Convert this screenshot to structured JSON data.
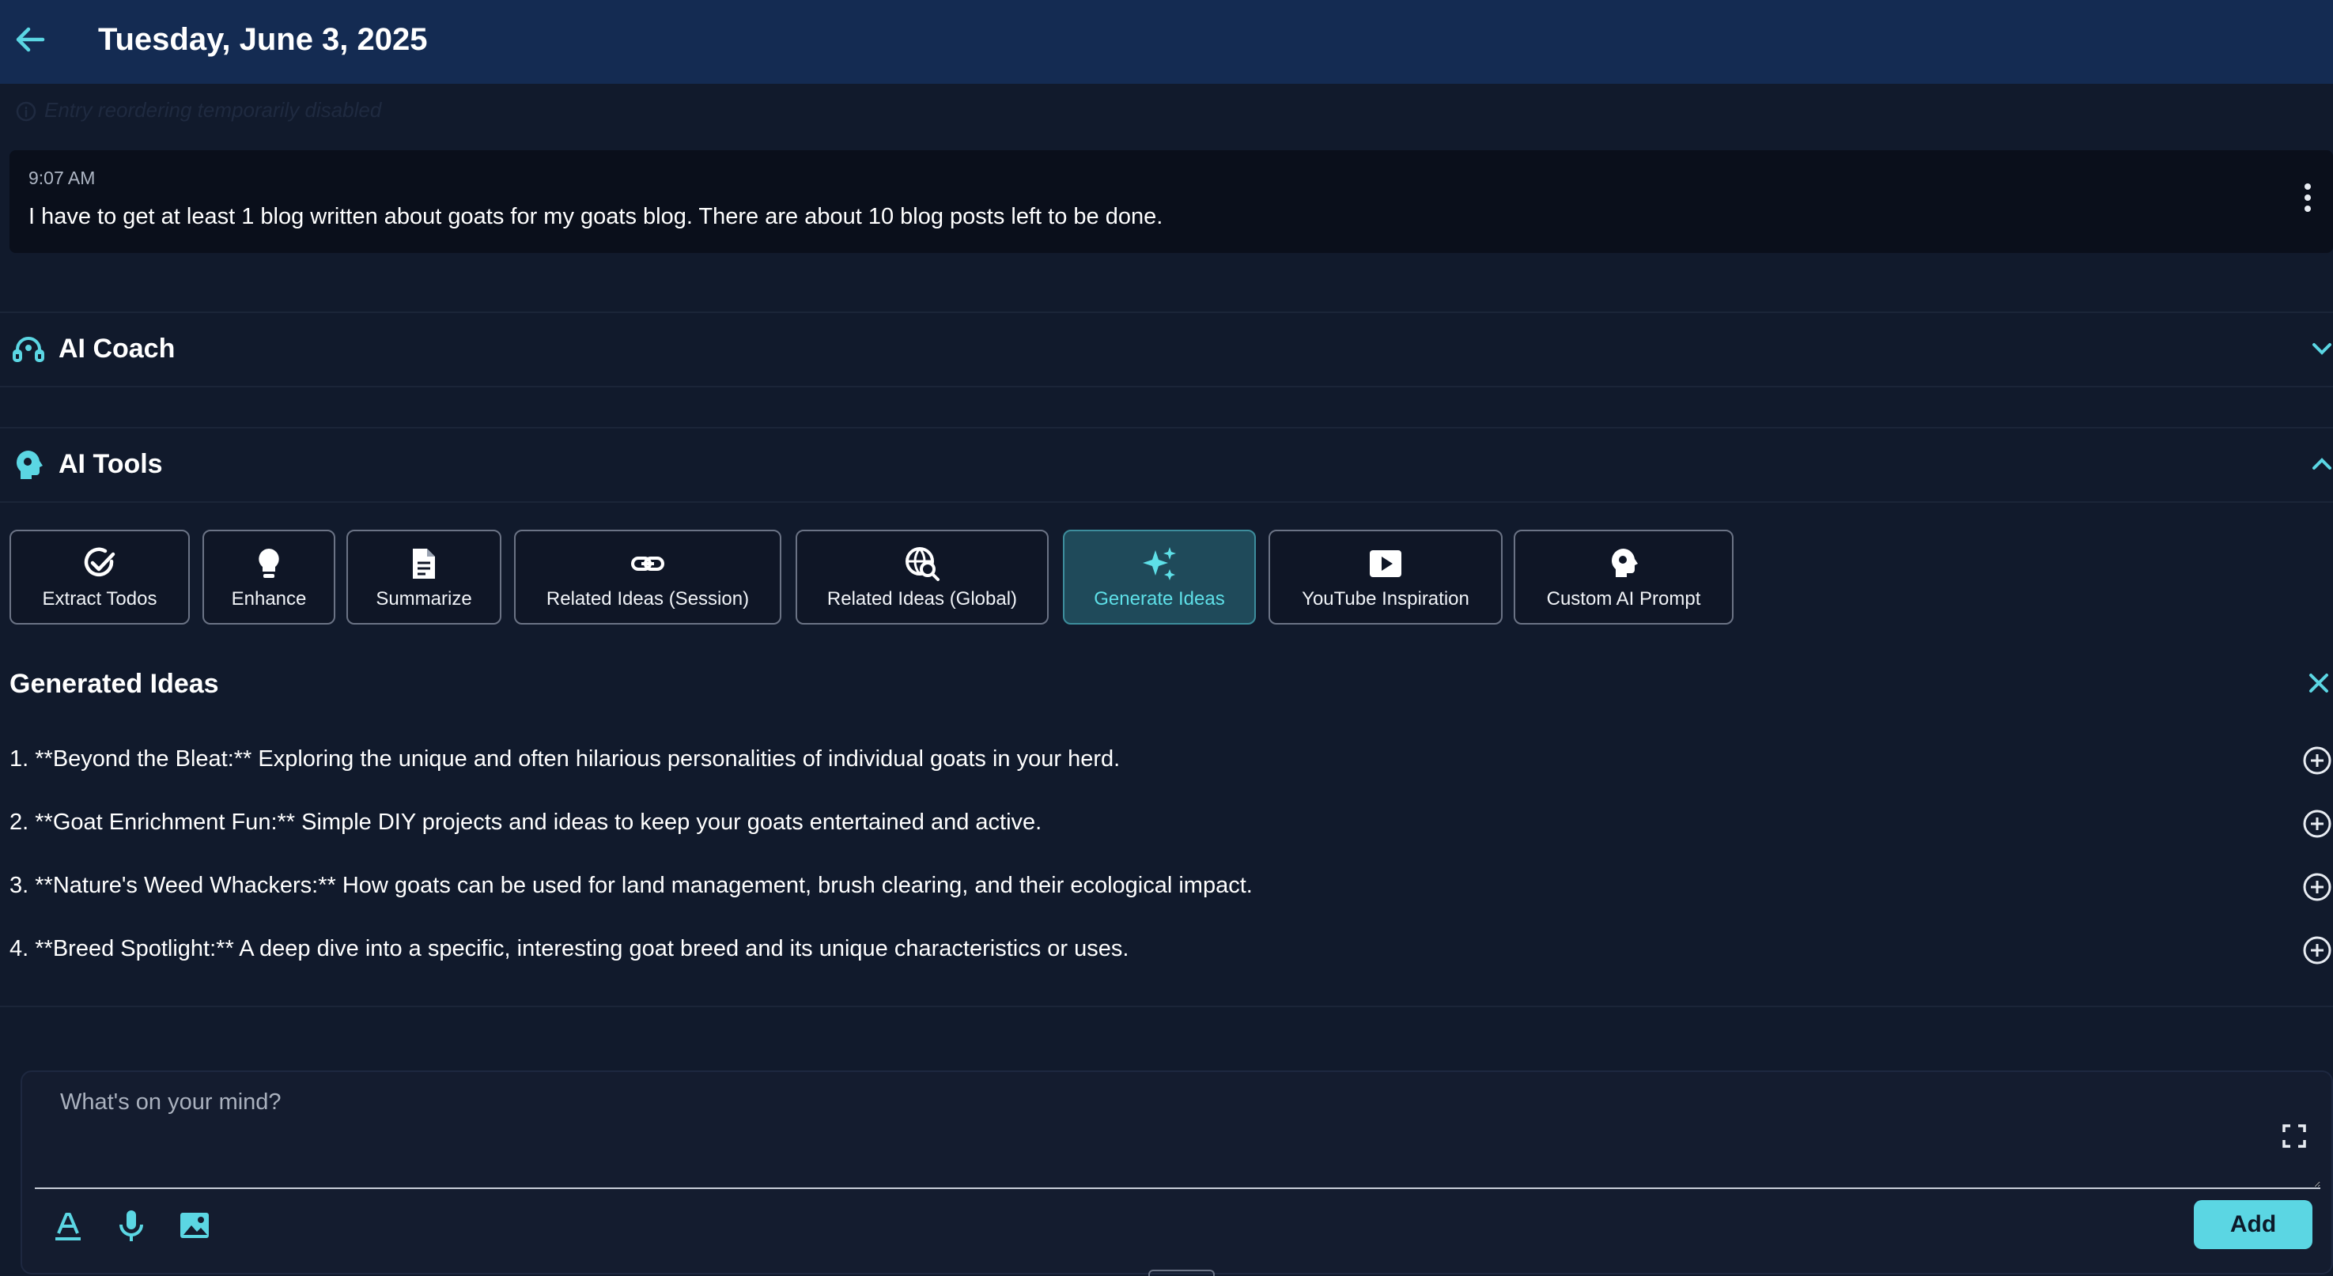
{
  "header": {
    "title": "Tuesday, June 3, 2025",
    "back_icon": "arrow-left-icon"
  },
  "notice": {
    "text": "Entry reordering temporarily disabled",
    "icon": "info-icon"
  },
  "entry": {
    "time": "9:07 AM",
    "text": "I have to get at least 1 blog written about goats for my goats blog. There are about 10 blog posts left to be done.",
    "menu_icon": "more-vertical-icon"
  },
  "ai_coach": {
    "label": "AI Coach",
    "icon": "headset-icon",
    "state": "collapsed"
  },
  "ai_tools": {
    "label": "AI Tools",
    "icon": "brain-gear-icon",
    "state": "expanded",
    "tools": [
      {
        "label": "Extract Todos",
        "icon": "check-circle-icon",
        "active": false
      },
      {
        "label": "Enhance",
        "icon": "lightbulb-icon",
        "active": false
      },
      {
        "label": "Summarize",
        "icon": "document-icon",
        "active": false
      },
      {
        "label": "Related Ideas (Session)",
        "icon": "link-icon",
        "active": false
      },
      {
        "label": "Related Ideas (Global)",
        "icon": "globe-search-icon",
        "active": false
      },
      {
        "label": "Generate Ideas",
        "icon": "sparkles-icon",
        "active": true
      },
      {
        "label": "YouTube Inspiration",
        "icon": "youtube-icon",
        "active": false
      },
      {
        "label": "Custom AI Prompt",
        "icon": "brain-gear-icon",
        "active": false
      }
    ]
  },
  "generated": {
    "title": "Generated Ideas",
    "ideas": [
      "1.  **Beyond the Bleat:** Exploring the unique and often hilarious personalities of individual goats in your herd.",
      "2.  **Goat Enrichment Fun:** Simple DIY projects and ideas to keep your goats entertained and active.",
      "3.  **Nature's Weed Whackers:** How goats can be used for land management, brush clearing, and their ecological impact.",
      "4.  **Breed Spotlight:** A deep dive into a specific, interesting goat breed and its unique characteristics or uses."
    ]
  },
  "composer": {
    "placeholder": "What's on your mind?",
    "add_label": "Add",
    "tools": [
      "text-format-icon",
      "microphone-icon",
      "image-icon"
    ]
  },
  "colors": {
    "accent": "#5bd6e3",
    "header_bg": "#142b52",
    "page_bg": "#111a2c",
    "active_tool_bg": "#1f4a5a"
  }
}
